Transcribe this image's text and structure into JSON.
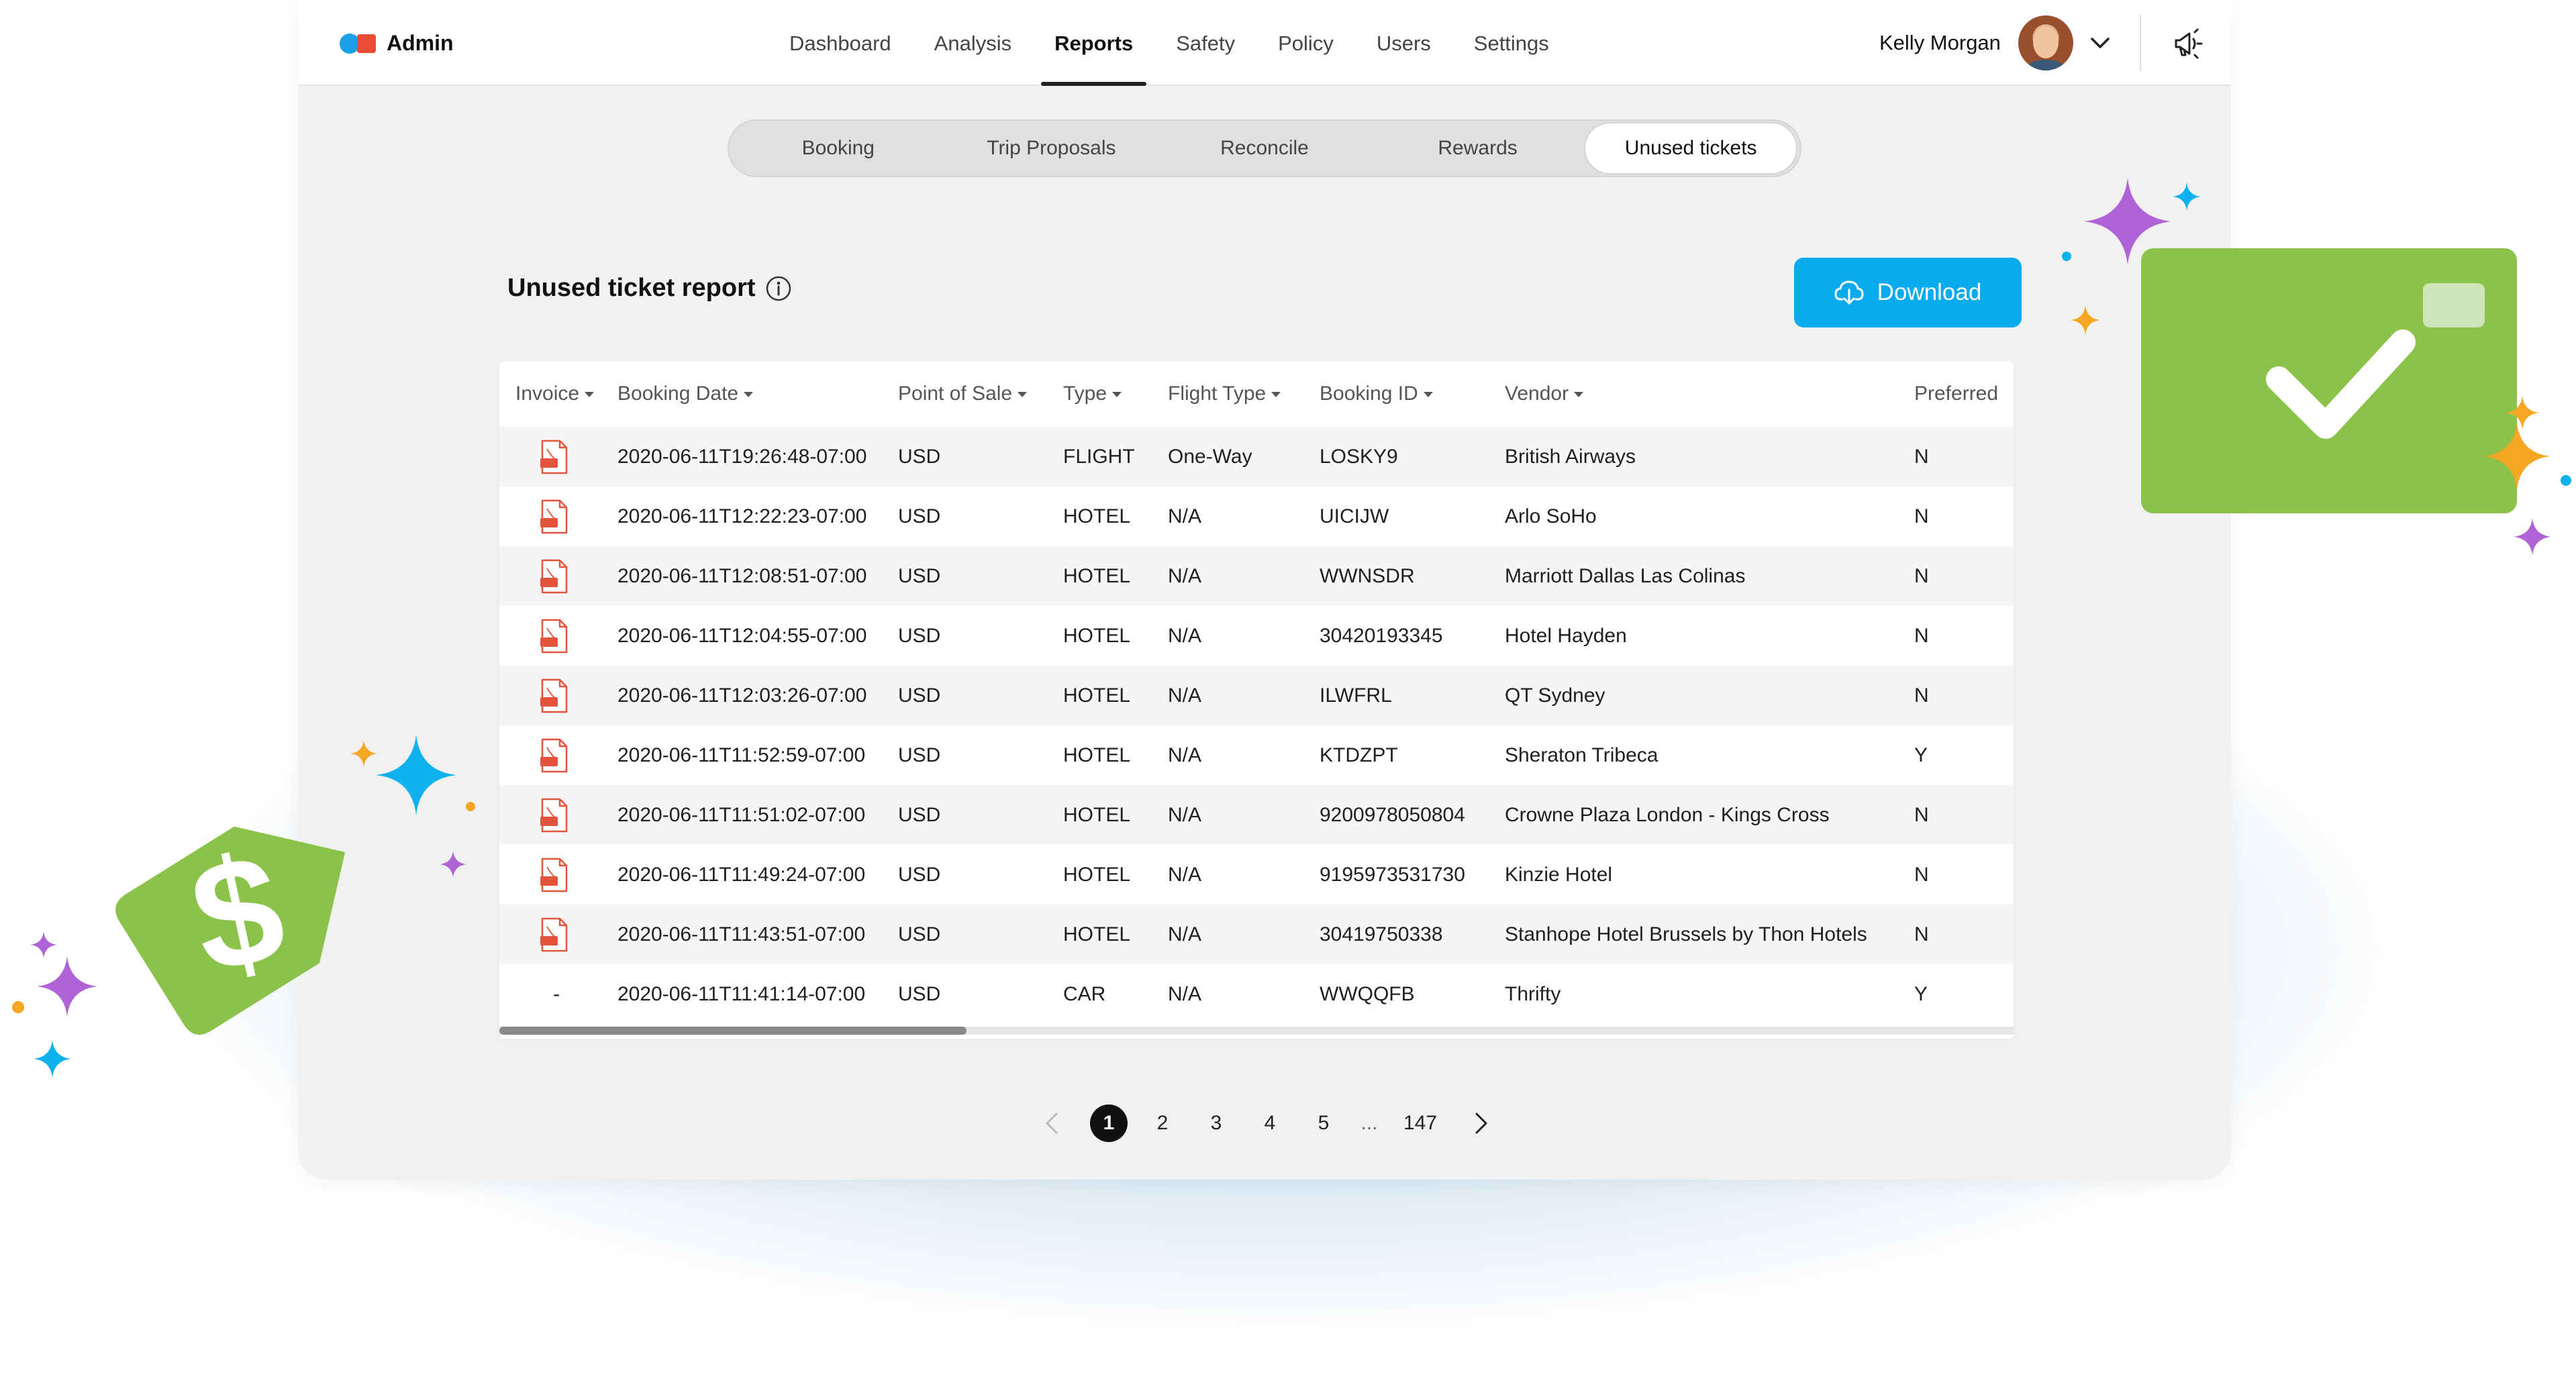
{
  "app": {
    "name": "Admin"
  },
  "nav": {
    "items": [
      {
        "label": "Dashboard"
      },
      {
        "label": "Analysis"
      },
      {
        "label": "Reports",
        "active": true
      },
      {
        "label": "Safety"
      },
      {
        "label": "Policy"
      },
      {
        "label": "Users"
      },
      {
        "label": "Settings"
      }
    ]
  },
  "user": {
    "name": "Kelly Morgan"
  },
  "subtabs": [
    {
      "label": "Booking"
    },
    {
      "label": "Trip Proposals"
    },
    {
      "label": "Reconcile"
    },
    {
      "label": "Rewards"
    },
    {
      "label": "Unused tickets",
      "active": true
    }
  ],
  "report": {
    "title": "Unused ticket report",
    "download_label": "Download"
  },
  "table": {
    "columns": [
      "Invoice",
      "Booking Date",
      "Point of Sale",
      "Type",
      "Flight Type",
      "Booking ID",
      "Vendor",
      "Preferred"
    ],
    "rows": [
      {
        "invoice": "pdf",
        "date": "2020-06-11T19:26:48-07:00",
        "pos": "USD",
        "type": "FLIGHT",
        "flight_type": "One-Way",
        "booking_id": "LOSKY9",
        "vendor": "British Airways",
        "preferred": "N"
      },
      {
        "invoice": "pdf",
        "date": "2020-06-11T12:22:23-07:00",
        "pos": "USD",
        "type": "HOTEL",
        "flight_type": "N/A",
        "booking_id": "UICIJW",
        "vendor": "Arlo SoHo",
        "preferred": "N"
      },
      {
        "invoice": "pdf",
        "date": "2020-06-11T12:08:51-07:00",
        "pos": "USD",
        "type": "HOTEL",
        "flight_type": "N/A",
        "booking_id": "WWNSDR",
        "vendor": "Marriott Dallas Las Colinas",
        "preferred": "N"
      },
      {
        "invoice": "pdf",
        "date": "2020-06-11T12:04:55-07:00",
        "pos": "USD",
        "type": "HOTEL",
        "flight_type": "N/A",
        "booking_id": "30420193345",
        "vendor": "Hotel Hayden",
        "preferred": "N"
      },
      {
        "invoice": "pdf",
        "date": "2020-06-11T12:03:26-07:00",
        "pos": "USD",
        "type": "HOTEL",
        "flight_type": "N/A",
        "booking_id": "ILWFRL",
        "vendor": "QT Sydney",
        "preferred": "N"
      },
      {
        "invoice": "pdf",
        "date": "2020-06-11T11:52:59-07:00",
        "pos": "USD",
        "type": "HOTEL",
        "flight_type": "N/A",
        "booking_id": "KTDZPT",
        "vendor": "Sheraton Tribeca",
        "preferred": "Y"
      },
      {
        "invoice": "pdf",
        "date": "2020-06-11T11:51:02-07:00",
        "pos": "USD",
        "type": "HOTEL",
        "flight_type": "N/A",
        "booking_id": "9200978050804",
        "vendor": "Crowne Plaza London - Kings Cross",
        "preferred": "N"
      },
      {
        "invoice": "pdf",
        "date": "2020-06-11T11:49:24-07:00",
        "pos": "USD",
        "type": "HOTEL",
        "flight_type": "N/A",
        "booking_id": "9195973531730",
        "vendor": "Kinzie Hotel",
        "preferred": "N"
      },
      {
        "invoice": "pdf",
        "date": "2020-06-11T11:43:51-07:00",
        "pos": "USD",
        "type": "HOTEL",
        "flight_type": "N/A",
        "booking_id": "30419750338",
        "vendor": "Stanhope Hotel Brussels by Thon Hotels",
        "preferred": "N"
      },
      {
        "invoice": "-",
        "date": "2020-06-11T11:41:14-07:00",
        "pos": "USD",
        "type": "CAR",
        "flight_type": "N/A",
        "booking_id": "WWQQFB",
        "vendor": "Thrifty",
        "preferred": "Y"
      }
    ]
  },
  "pagination": {
    "pages": [
      "1",
      "2",
      "3",
      "4",
      "5"
    ],
    "ellipsis": "...",
    "last": "147",
    "current": "1"
  },
  "icons": {
    "info": "info-icon",
    "download": "cloud-download-icon",
    "pdf": "pdf-file-icon",
    "megaphone": "megaphone-icon",
    "chevron": "chevron-down-icon",
    "price_tag": "dollar-tag-icon",
    "check": "checkmark-icon"
  },
  "colors": {
    "accent": "#0aaaee",
    "green": "#8bc34a",
    "logo_blue": "#1a9ee6",
    "logo_red": "#ea4b35",
    "sparkle_purple": "#b063d6",
    "sparkle_cyan": "#0fb1ee",
    "sparkle_orange": "#f5a623"
  }
}
